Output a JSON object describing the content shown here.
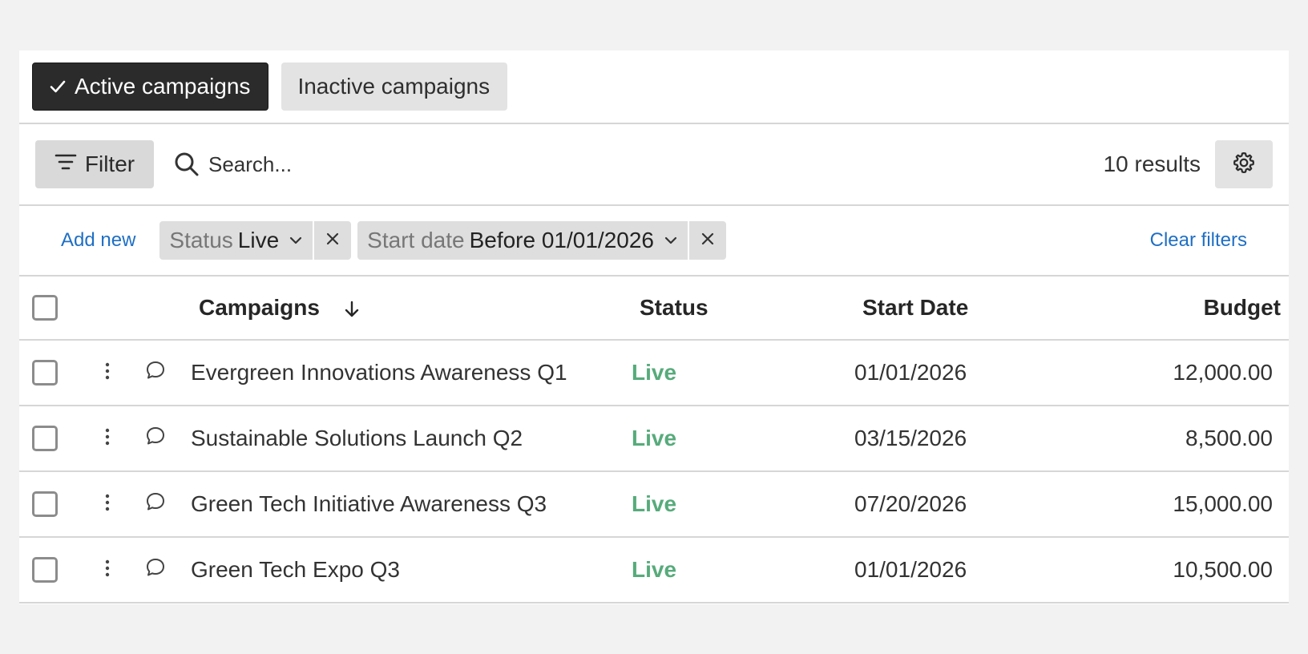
{
  "tabs": [
    {
      "label": "Active campaigns",
      "active": true
    },
    {
      "label": "Inactive campaigns",
      "active": false
    }
  ],
  "toolbar": {
    "filter_label": "Filter",
    "search_placeholder": "Search...",
    "results": "10 results"
  },
  "filters": {
    "add_new": "Add new",
    "chips": [
      {
        "key": "Status",
        "value": "Live"
      },
      {
        "key": "Start date",
        "value": "Before 01/01/2026"
      }
    ],
    "clear": "Clear filters"
  },
  "table": {
    "columns": {
      "campaigns": "Campaigns",
      "status": "Status",
      "start_date": "Start Date",
      "budget": "Budget"
    },
    "rows": [
      {
        "name": "Evergreen Innovations Awareness Q1",
        "status": "Live",
        "start_date": "01/01/2026",
        "budget": "12,000.00"
      },
      {
        "name": "Sustainable Solutions Launch Q2",
        "status": "Live",
        "start_date": "03/15/2026",
        "budget": "8,500.00"
      },
      {
        "name": "Green Tech Initiative Awareness Q3",
        "status": "Live",
        "start_date": "07/20/2026",
        "budget": "15,000.00"
      },
      {
        "name": "Green Tech Expo Q3",
        "status": "Live",
        "start_date": "01/01/2026",
        "budget": "10,500.00"
      }
    ]
  },
  "colors": {
    "accent_link": "#1f6fc4",
    "status_live": "#57ab7b",
    "active_tab": "#2b2b2b"
  },
  "icons": {
    "check": "check-icon",
    "filter": "filter-lines-icon",
    "search": "search-icon",
    "settings": "gear-icon",
    "caret": "chevron-down-icon",
    "close": "close-icon",
    "sort": "arrow-down-icon",
    "menu": "kebab-menu-icon",
    "comment": "comment-icon"
  }
}
